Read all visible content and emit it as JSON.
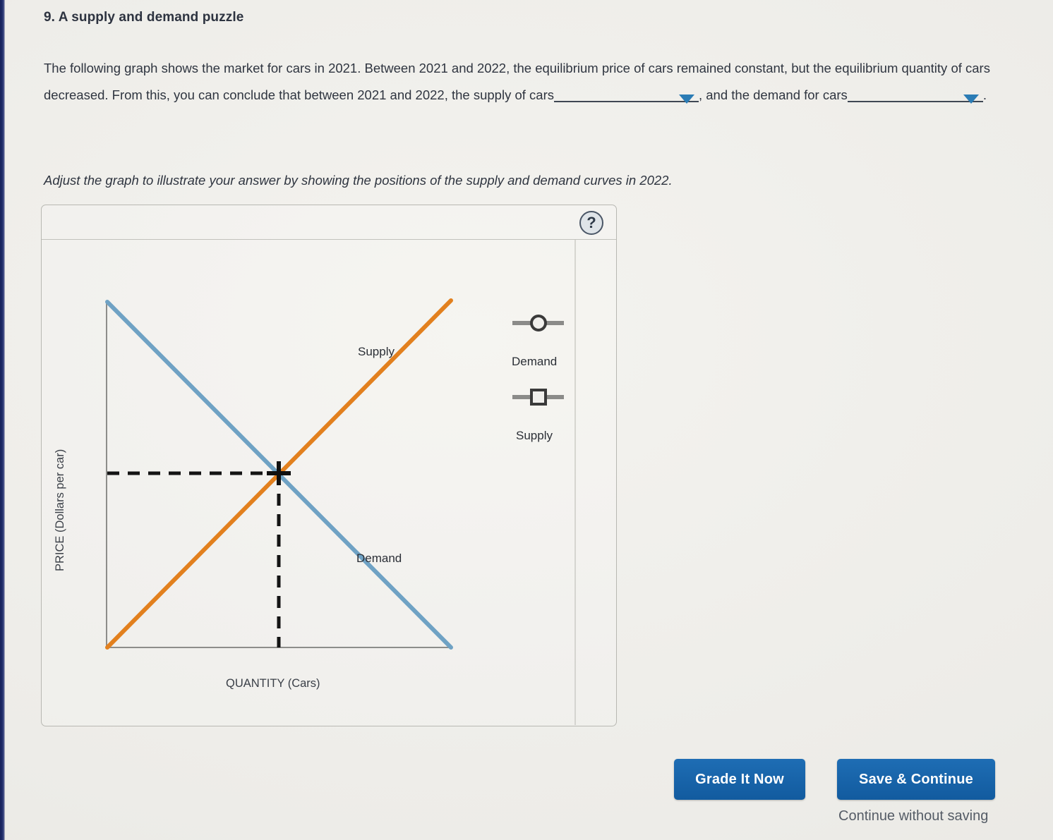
{
  "question": {
    "number_title": "9. A supply and demand puzzle",
    "body_part1": "The following graph shows the market for cars in 2021. Between 2021 and 2022, the equilibrium price of cars remained constant, but the equilibrium quantity of cars decreased. From this, you can conclude that between 2021 and 2022, the supply of cars",
    "body_part2": ", and the demand for cars",
    "body_part3": ".",
    "dropdown_supply_value": "",
    "dropdown_demand_value": "",
    "dropdown_caret_icon": "caret-down-icon"
  },
  "instruction": "Adjust the graph to illustrate your answer by showing the positions of the supply and demand curves in 2022.",
  "panel": {
    "help_label": "?",
    "help_icon": "question-mark-icon"
  },
  "chart_data": {
    "type": "line",
    "title": "",
    "xlabel": "QUANTITY (Cars)",
    "ylabel": "PRICE (Dollars per car)",
    "series": [
      {
        "name": "Demand",
        "color": "#6fa2c4",
        "label": "Demand",
        "points": [
          [
            0,
            100
          ],
          [
            100,
            0
          ]
        ]
      },
      {
        "name": "Supply",
        "color": "#e2801e",
        "label": "Supply",
        "points": [
          [
            0,
            0
          ],
          [
            100,
            100
          ]
        ]
      }
    ],
    "equilibrium": {
      "marker": "plus-crosshair",
      "color": "#111111",
      "x": 50,
      "y": 50,
      "guide_style": "dashed"
    },
    "xlim": [
      0,
      110
    ],
    "ylim": [
      0,
      110
    ],
    "grid": false,
    "axis_color": "#8d8d8a"
  },
  "legend_controls": [
    {
      "name": "Demand",
      "label": "Demand",
      "handle": "circle",
      "track_color": "#8b8b89",
      "handle_color": "#3a3a3a"
    },
    {
      "name": "Supply",
      "label": "Supply",
      "handle": "square",
      "track_color": "#8b8b89",
      "handle_color": "#3a3a3a"
    }
  ],
  "actions": {
    "grade_label": "Grade It Now",
    "save_label": "Save & Continue",
    "continue_label": "Continue without saving",
    "accent_color": "#1763a8"
  }
}
